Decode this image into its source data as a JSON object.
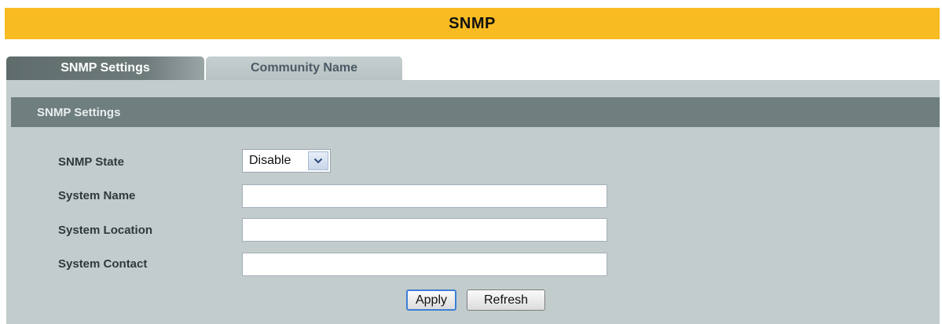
{
  "page": {
    "title": "SNMP"
  },
  "tabs": [
    {
      "label": "SNMP Settings",
      "active": true
    },
    {
      "label": "Community Name",
      "active": false
    }
  ],
  "section": {
    "title": "SNMP Settings"
  },
  "form": {
    "snmp_state": {
      "label": "SNMP State",
      "value": "Disable",
      "icon": "chevron-down-icon"
    },
    "system_name": {
      "label": "System Name",
      "value": "",
      "placeholder": ""
    },
    "system_location": {
      "label": "System Location",
      "value": "",
      "placeholder": ""
    },
    "system_contact": {
      "label": "System Contact",
      "value": "",
      "placeholder": ""
    }
  },
  "buttons": {
    "apply_label": "Apply",
    "refresh_label": "Refresh"
  },
  "colors": {
    "title_bar": "#f8bb22",
    "active_tab": "#6e7b7b",
    "inactive_tab": "#c1caca",
    "section_header": "#6f7e7e",
    "panel_background": "#c3cccc",
    "apply_focus_border": "#3c7fd6"
  }
}
